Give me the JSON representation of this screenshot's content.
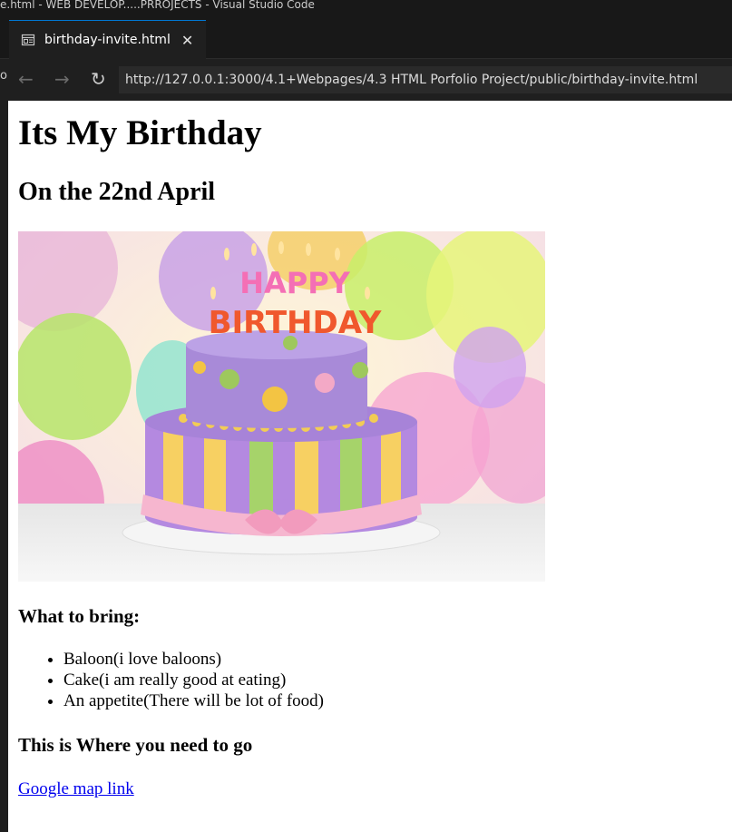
{
  "window": {
    "title": "e.html - WEB DEVELOP.....PRROJECTS - Visual Studio Code"
  },
  "tab": {
    "label": "birthday-invite.html",
    "icon": "preview-icon",
    "close_glyph": "✕"
  },
  "browser": {
    "back_glyph": "←",
    "forward_glyph": "→",
    "reload_glyph": "↻",
    "edge_glyph": "o",
    "url": "http://127.0.0.1:3000/4.1+Webpages/4.3 HTML Porfolio Project/public/birthday-invite.html"
  },
  "page": {
    "h1": "Its My Birthday",
    "h2": "On the 22nd April",
    "image": {
      "topper_line1": "HAPPY",
      "topper_line2": "BIRTHDAY"
    },
    "bring_heading": "What to bring:",
    "bring_items": [
      "Baloon(i love baloons)",
      "Cake(i am really good at eating)",
      "An appetite(There will be lot of food)"
    ],
    "where_heading": "This is Where you need to go",
    "map_link": "Google map link"
  },
  "colors": {
    "accent": "#0078d4",
    "link": "#0000ee",
    "page_background": "#ffffff",
    "editor_background": "#1f1f1f"
  }
}
